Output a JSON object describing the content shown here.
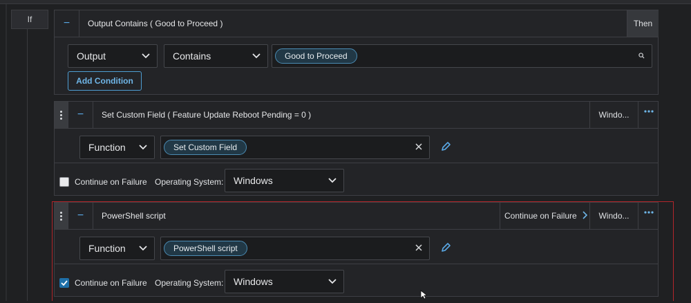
{
  "if_label": "If",
  "condition": {
    "title": "Output Contains ( Good to Proceed )",
    "then_label": "Then",
    "field_select": "Output",
    "operator_select": "Contains",
    "value_chip": "Good to Proceed",
    "add_condition_label": "Add Condition"
  },
  "steps": [
    {
      "title": "Set Custom Field ( Feature Update Reboot Pending = 0 )",
      "os_short": "Windo...",
      "type_select": "Function",
      "function_chip": "Set Custom Field",
      "continue_label": "Continue on Failure",
      "continue_checked": false,
      "os_label": "Operating System:",
      "os_select": "Windows"
    },
    {
      "title": "PowerShell script",
      "header_continue": "Continue on Failure",
      "os_short": "Windo...",
      "type_select": "Function",
      "function_chip": "PowerShell script",
      "continue_label": "Continue on Failure",
      "continue_checked": true,
      "os_label": "Operating System:",
      "os_select": "Windows"
    }
  ],
  "colors": {
    "accent": "#5aa9e6",
    "selection_border": "#b3262b"
  }
}
